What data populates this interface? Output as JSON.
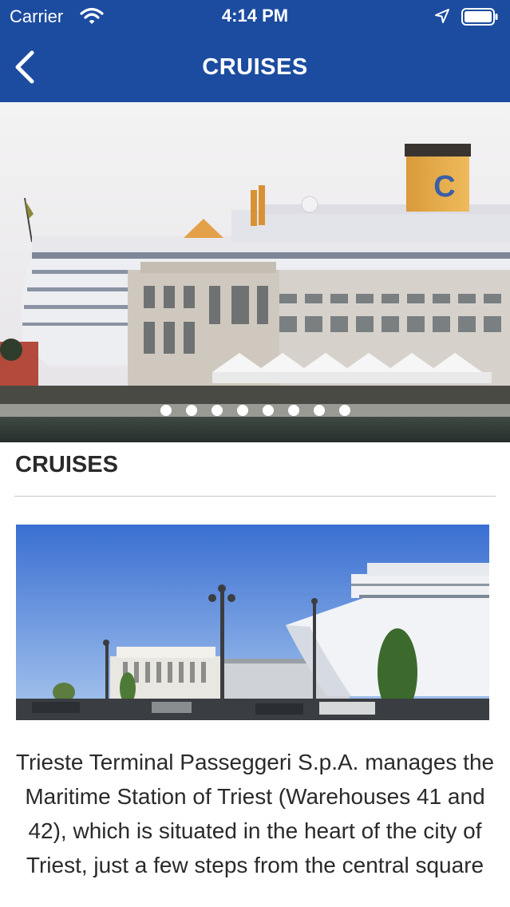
{
  "status_bar": {
    "carrier": "Carrier",
    "time": "4:14 PM"
  },
  "nav": {
    "title": "CRUISES"
  },
  "carousel": {
    "slide_count": 8,
    "active_index": 0
  },
  "content": {
    "section_title": "CRUISES",
    "paragraph": "Trieste Terminal Passeggeri S.p.A. manages the Maritime Station of Triest (Warehouses 41 and 42), which is situated in the heart of the city of Triest, just a few steps from the central square"
  },
  "icons": {
    "back": "chevron-left-icon",
    "wifi": "wifi-icon",
    "location": "location-arrow-icon",
    "battery": "battery-icon"
  },
  "colors": {
    "nav_bar": "#1c4ca0",
    "text": "#2a2a2a",
    "divider": "#c9c9c9"
  }
}
